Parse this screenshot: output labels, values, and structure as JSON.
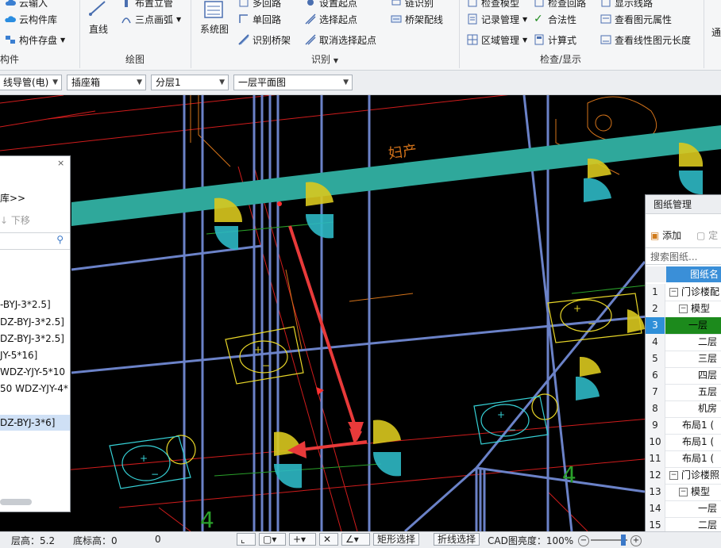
{
  "ribbon": {
    "group1": {
      "cloud_import": "云输入",
      "cloud_library": "云构件库",
      "component_save": "构件存盘",
      "group_label": "构件"
    },
    "draw": {
      "line": "直线",
      "arrange_wall": "布置立管",
      "three_point_arc": "三点画弧",
      "group_label": "绘图"
    },
    "identify": {
      "system_diagram": "系统图",
      "multi_loop": "多回路",
      "single_loop": "单回路",
      "identify_tray": "识别桥架",
      "set_start": "设置起点",
      "select_start": "选择起点",
      "cancel_select_start": "取消选择起点",
      "tray_wiring": "桥架配线",
      "chain_identify": "链识别",
      "group_label": "识别"
    },
    "check": {
      "check_model": "检查模型",
      "check_loop": "检查回路",
      "show_path": "显示线路",
      "record_manage": "记录管理",
      "legality": "合法性",
      "view_element_attr": "查看图元属性",
      "area_manage": "区域管理",
      "formula": "计算式",
      "view_linear_length": "查看线性图元长度",
      "group_label": "检查/显示",
      "general": "通"
    }
  },
  "propbar": {
    "type_select": "线导管(电)",
    "component_select": "插座箱",
    "layer_select": "分层1",
    "floor_select": "一层平面图"
  },
  "canvas": {
    "annotation": "妇产",
    "number_labels": [
      "4",
      "4"
    ]
  },
  "left_panel": {
    "library": "库>>",
    "move_down": "下移",
    "items": [
      "-BYJ-3*2.5]",
      "DZ-BYJ-3*2.5]",
      "DZ-BYJ-3*2.5]",
      "JY-5*16]",
      "WDZ-YJY-5*10",
      "50 WDZ-YJY-4*",
      "DZ-BYJ-3*6]"
    ]
  },
  "right_panel": {
    "title": "图纸管理",
    "add": "添加",
    "locate": "定",
    "search_placeholder": "搜索图纸...",
    "column_header": "图纸名",
    "rows": [
      {
        "num": "1",
        "text": "门诊楼配",
        "exp": "−"
      },
      {
        "num": "2",
        "text": "模型",
        "exp": "−"
      },
      {
        "num": "3",
        "text": "一层",
        "exp": ""
      },
      {
        "num": "4",
        "text": "二层",
        "exp": ""
      },
      {
        "num": "5",
        "text": "三层",
        "exp": ""
      },
      {
        "num": "6",
        "text": "四层",
        "exp": ""
      },
      {
        "num": "7",
        "text": "五层",
        "exp": ""
      },
      {
        "num": "8",
        "text": "机房",
        "exp": ""
      },
      {
        "num": "9",
        "text": "布局1 (",
        "exp": ""
      },
      {
        "num": "10",
        "text": "布局1 (",
        "exp": ""
      },
      {
        "num": "11",
        "text": "布局1 (",
        "exp": ""
      },
      {
        "num": "12",
        "text": "门诊楼照",
        "exp": "−"
      },
      {
        "num": "13",
        "text": "模型",
        "exp": "−"
      },
      {
        "num": "14",
        "text": "一层",
        "exp": ""
      },
      {
        "num": "15",
        "text": "二层",
        "exp": ""
      }
    ]
  },
  "status": {
    "floor_height": "层高：5.2",
    "base_height": "底标高：0",
    "zero": "0",
    "rect_select": "矩形选择",
    "polyline_select": "折线选择",
    "cad_height": "CAD图亮度：100%"
  },
  "colors": {
    "canvas_bg": "#000000",
    "cyan_tray": "#2fa89b",
    "red_arrow": "#e83a3a",
    "selection_green": "#1c8a1c"
  }
}
